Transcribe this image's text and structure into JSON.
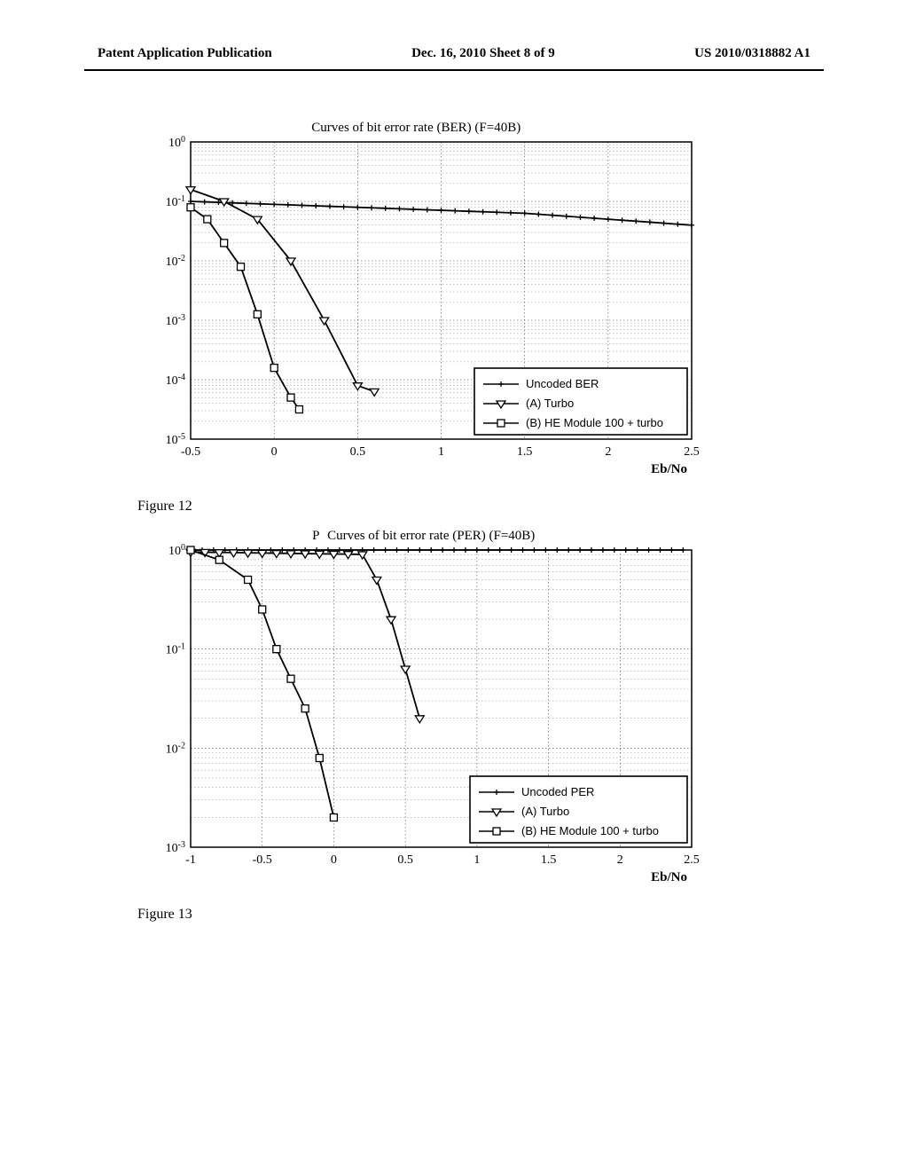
{
  "header": {
    "left": "Patent Application Publication",
    "center": "Dec. 16, 2010  Sheet 8 of 9",
    "right": "US 2010/0318882 A1"
  },
  "fig12": {
    "caption": "Figure 12",
    "title": "Curves of bit error rate   (BER) (F=40B)",
    "xlabel": "Eb/No",
    "legend": {
      "a": "Uncoded BER",
      "b": "(A)  Turbo",
      "c": "(B) HE Module 100 + turbo"
    }
  },
  "fig13": {
    "caption": "Figure 13",
    "title": "Curves of bit error rate   (PER) (F=40B)",
    "topLabel": "P",
    "xlabel": "Eb/No",
    "legend": {
      "a": "Uncoded PER",
      "b": "(A)  Turbo",
      "c": "(B) HE Module 100 + turbo"
    }
  },
  "chart_data": [
    {
      "type": "line",
      "title": "Curves of bit error rate (BER) (F=40B)",
      "xlabel": "Eb/No",
      "ylabel": "",
      "xlim": [
        -0.5,
        2.5
      ],
      "ylim_log10": [
        -5,
        0
      ],
      "x_ticks": [
        -0.5,
        0,
        0.5,
        1,
        1.5,
        2,
        2.5
      ],
      "y_ticks_log10": [
        0,
        -1,
        -2,
        -3,
        -4,
        -5
      ],
      "series": [
        {
          "name": "Uncoded BER",
          "x": [
            -0.5,
            0,
            0.5,
            1,
            1.5,
            2,
            2.5
          ],
          "y_log10": [
            -1.0,
            -1.05,
            -1.1,
            -1.15,
            -1.2,
            -1.3,
            -1.4
          ]
        },
        {
          "name": "(A) Turbo",
          "x": [
            -0.5,
            -0.3,
            -0.1,
            0.1,
            0.3,
            0.5,
            0.6
          ],
          "y_log10": [
            -0.8,
            -1.0,
            -1.3,
            -2.0,
            -3.0,
            -4.1,
            -4.2
          ]
        },
        {
          "name": "(B) HE Module 100 + turbo",
          "x": [
            -0.5,
            -0.4,
            -0.3,
            -0.2,
            -0.1,
            0.0,
            0.1,
            0.15
          ],
          "y_log10": [
            -1.1,
            -1.3,
            -1.7,
            -2.1,
            -2.9,
            -3.8,
            -4.3,
            -4.5
          ]
        }
      ]
    },
    {
      "type": "line",
      "title": "Curves of bit error rate (PER) (F=40B)",
      "xlabel": "Eb/No",
      "ylabel": "",
      "xlim": [
        -1,
        2.5
      ],
      "ylim_log10": [
        -3,
        0
      ],
      "x_ticks": [
        -1,
        -0.5,
        0,
        0.5,
        1,
        1.5,
        2,
        2.5
      ],
      "y_ticks_log10": [
        0,
        -1,
        -2,
        -3
      ],
      "series": [
        {
          "name": "Uncoded PER",
          "x": [
            -1,
            -0.5,
            0,
            0.5,
            1,
            1.5,
            2,
            2.5
          ],
          "y_log10": [
            0,
            0,
            0,
            0,
            0,
            0,
            0,
            0
          ]
        },
        {
          "name": "(A) Turbo",
          "x": [
            -1,
            -0.5,
            0,
            0.3,
            0.4,
            0.5,
            0.6
          ],
          "y_log10": [
            0,
            -0.02,
            -0.05,
            -0.3,
            -0.7,
            -1.2,
            -1.7
          ]
        },
        {
          "name": "(B) HE Module 100 + turbo",
          "x": [
            -1,
            -0.8,
            -0.6,
            -0.5,
            -0.4,
            -0.3,
            -0.2,
            -0.1,
            0.0
          ],
          "y_log10": [
            0,
            -0.1,
            -0.3,
            -0.6,
            -1.0,
            -1.3,
            -1.6,
            -2.1,
            -2.7
          ]
        }
      ]
    }
  ]
}
